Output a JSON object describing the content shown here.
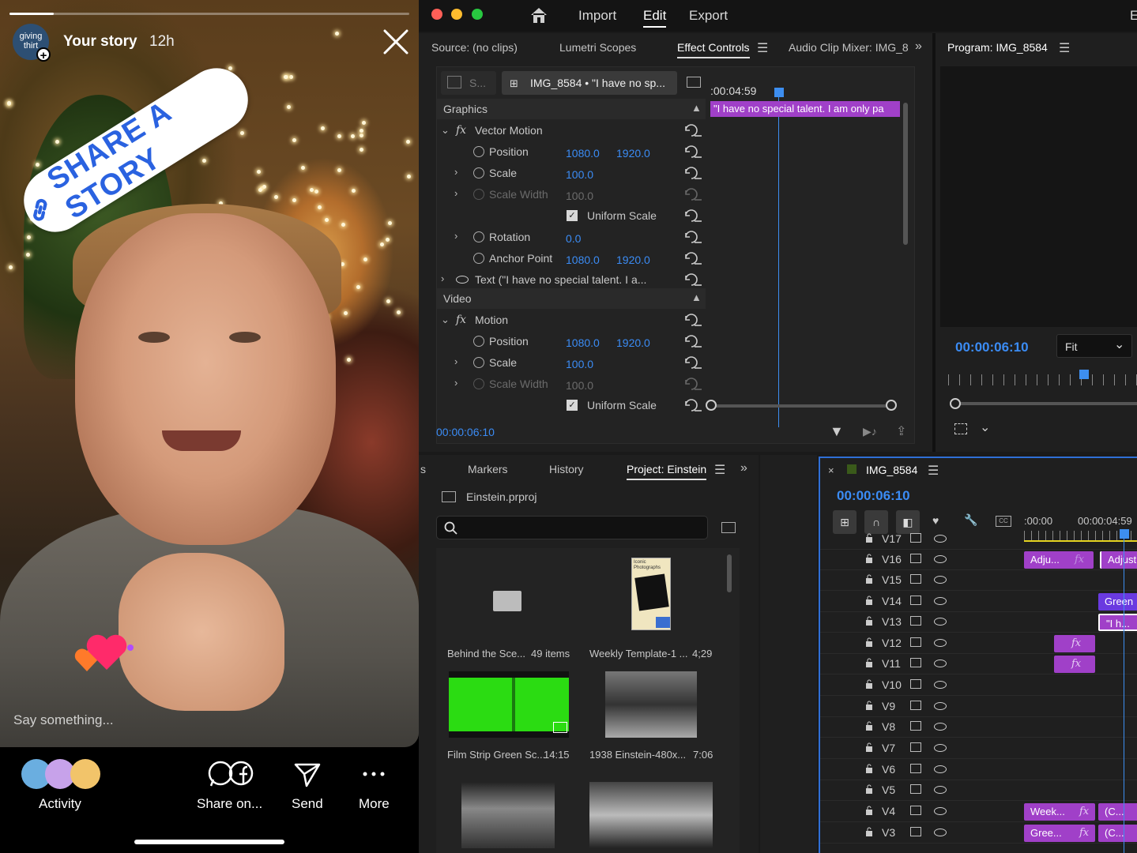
{
  "story": {
    "avatar_text": "giving thirt",
    "username": "Your story",
    "time": "12h",
    "progress": 0.11,
    "sticker_text": "SHARE A STORY",
    "reply_placeholder": "Say something...",
    "actions": [
      {
        "label": "Activity",
        "icon": "avatars-stack-icon"
      },
      {
        "label": "Share on...",
        "icon": "whatsapp-facebook-icon"
      },
      {
        "label": "Send",
        "icon": "send-icon"
      },
      {
        "label": "More",
        "icon": "more-dots-icon"
      }
    ]
  },
  "premiere": {
    "menu": {
      "home": "home-icon",
      "import": "Import",
      "edit": "Edit",
      "export": "Export"
    },
    "source_tabs": [
      "Source: (no clips)",
      "Lumetri Scopes",
      "Effect Controls",
      "Audio Clip Mixer: IMG_8"
    ],
    "program_title": "Program: IMG_8584",
    "effect_controls": {
      "source_short": "S...",
      "clip_label": "IMG_8584 • \"I have no sp...",
      "timecode_head": ":00:04:59",
      "caption_clip": "\"I have no special talent.  I am only pa",
      "sections": {
        "graphics": "Graphics",
        "vector_motion": "Vector Motion",
        "video": "Video",
        "motion": "Motion"
      },
      "graphics_props": [
        {
          "name": "Position",
          "v1": "1080.0",
          "v2": "1920.0"
        },
        {
          "name": "Scale",
          "v1": "100.0"
        },
        {
          "name": "Scale Width",
          "v1": "100.0"
        },
        {
          "name": "Uniform Scale",
          "checked": true
        },
        {
          "name": "Rotation",
          "v1": "0.0"
        },
        {
          "name": "Anchor Point",
          "v1": "1080.0",
          "v2": "1920.0"
        }
      ],
      "text_layer": "Text (\"I have no special talent.  I a...",
      "video_props": [
        {
          "name": "Position",
          "v1": "1080.0",
          "v2": "1920.0"
        },
        {
          "name": "Scale",
          "v1": "100.0"
        },
        {
          "name": "Scale Width",
          "v1": "100.0"
        },
        {
          "name": "Uniform Scale",
          "checked": true
        }
      ],
      "timecode": "00:00:06:10"
    },
    "program": {
      "timecode": "00:00:06:10",
      "fit": "Fit"
    },
    "project": {
      "tabs": [
        "s",
        "Markers",
        "History",
        "Project: Einstein"
      ],
      "file": "Einstein.prproj",
      "search_placeholder": "",
      "items": [
        {
          "name": "Behind the Sce...",
          "meta": "49 items"
        },
        {
          "name": "Weekly Template-1 ...",
          "meta": "4;29"
        },
        {
          "name": "Film Strip Green Sc...",
          "meta": "14:15"
        },
        {
          "name": "1938 Einstein-480x...",
          "meta": "7:06"
        }
      ],
      "thumb_text": "Iconic Photographs"
    },
    "timeline": {
      "title": "IMG_8584",
      "timecode": "00:00:06:10",
      "ruler": [
        ":00:00",
        "00:00:04:59"
      ],
      "tracks": [
        "V17",
        "V16",
        "V15",
        "V14",
        "V13",
        "V12",
        "V11",
        "V10",
        "V9",
        "V8",
        "V7",
        "V6",
        "V5",
        "V4",
        "V3"
      ],
      "clips": {
        "v16a": "Adju...",
        "v16b": "Adjust",
        "v14": "Green",
        "v13": "\"I h...",
        "v4a": "Week...",
        "v4b": "(C...",
        "v3a": "Gree...",
        "v3b": "(C..."
      },
      "fx_label": "fx"
    },
    "colors": {
      "accent": "#3b8cf5",
      "clip": "#a040c8",
      "playhead": "#3d8ef0"
    }
  }
}
